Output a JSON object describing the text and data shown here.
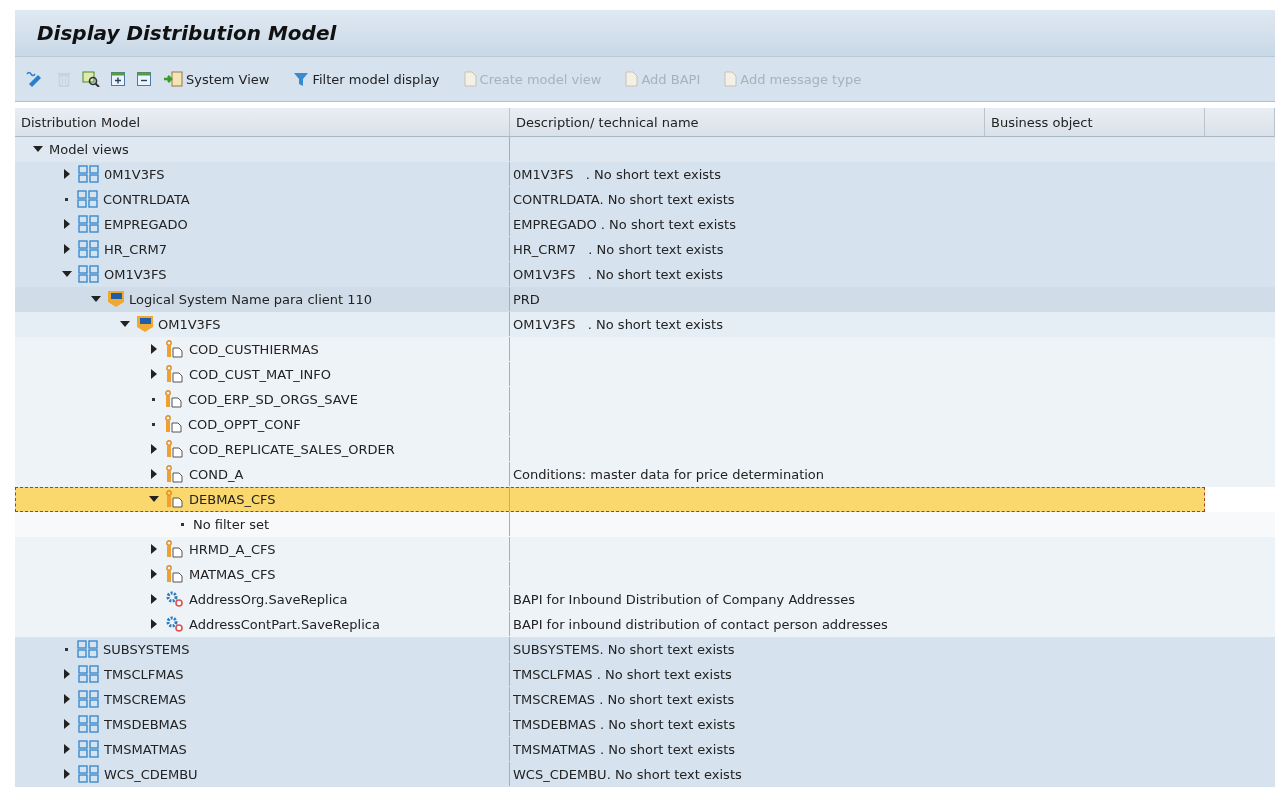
{
  "title": "Display Distribution Model",
  "toolbar": {
    "icon_buttons": [
      {
        "kind": "edit",
        "disabled": false
      },
      {
        "kind": "delete",
        "disabled": true
      },
      {
        "kind": "find",
        "disabled": false
      },
      {
        "kind": "expand",
        "disabled": false
      },
      {
        "kind": "collapse",
        "disabled": false
      }
    ],
    "buttons": [
      {
        "label": "System View",
        "kind": "system",
        "disabled": false
      },
      {
        "label": "Filter model display",
        "kind": "filter",
        "disabled": false
      },
      {
        "label": "Create model view",
        "kind": "document",
        "disabled": true
      },
      {
        "label": "Add BAPI",
        "kind": "document",
        "disabled": true
      },
      {
        "label": "Add message type",
        "kind": "document",
        "disabled": true
      }
    ]
  },
  "table": {
    "columns": [
      "Distribution Model",
      "Description/ technical name",
      "Business object"
    ],
    "tree": [
      {
        "label": "Model views",
        "kind": "folder",
        "leaf": false,
        "expanded": true,
        "selected": false,
        "children": [
          {
            "label": "0M1V3FS",
            "description": "0M1V3FS   . No short text exists",
            "kind": "model_view",
            "leaf": false,
            "expanded": false,
            "selected": false
          },
          {
            "label": "CONTRLDATA",
            "description": "CONTRLDATA. No short text exists",
            "kind": "model_view",
            "leaf": true,
            "selected": false
          },
          {
            "label": "EMPREGADO",
            "description": "EMPREGADO . No short text exists",
            "kind": "model_view",
            "leaf": false,
            "expanded": false,
            "selected": false
          },
          {
            "label": "HR_CRM7",
            "description": "HR_CRM7   . No short text exists",
            "kind": "model_view",
            "leaf": false,
            "expanded": false,
            "selected": false
          },
          {
            "label": "OM1V3FS",
            "description": "OM1V3FS   . No short text exists",
            "kind": "model_view",
            "leaf": false,
            "expanded": true,
            "selected": false,
            "children": [
              {
                "label": "Logical System Name para client 110",
                "description": "PRD",
                "kind": "sender_system",
                "leaf": false,
                "expanded": true,
                "selected": false,
                "children": [
                  {
                    "label": "OM1V3FS",
                    "description": "OM1V3FS   . No short text exists",
                    "kind": "receiver_system",
                    "leaf": false,
                    "expanded": true,
                    "selected": false,
                    "children": [
                      {
                        "label": "COD_CUSTHIERMAS",
                        "kind": "message_type",
                        "leaf": false,
                        "expanded": false,
                        "selected": false
                      },
                      {
                        "label": "COD_CUST_MAT_INFO",
                        "kind": "message_type",
                        "leaf": false,
                        "expanded": false,
                        "selected": false
                      },
                      {
                        "label": "COD_ERP_SD_ORGS_SAVE",
                        "kind": "message_type",
                        "leaf": true,
                        "selected": false
                      },
                      {
                        "label": "COD_OPPT_CONF",
                        "kind": "message_type",
                        "leaf": true,
                        "selected": false
                      },
                      {
                        "label": "COD_REPLICATE_SALES_ORDER",
                        "kind": "message_type",
                        "leaf": false,
                        "expanded": false,
                        "selected": false
                      },
                      {
                        "label": "COND_A",
                        "description": "Conditions: master data for price determination",
                        "kind": "message_type",
                        "leaf": false,
                        "expanded": false,
                        "selected": false
                      },
                      {
                        "label": "DEBMAS_CFS",
                        "kind": "message_type",
                        "leaf": false,
                        "expanded": true,
                        "selected": true,
                        "children": [
                          {
                            "label": "No filter set",
                            "kind": "filter",
                            "leaf": true,
                            "selected": false
                          }
                        ]
                      },
                      {
                        "label": "HRMD_A_CFS",
                        "kind": "message_type",
                        "leaf": false,
                        "expanded": false,
                        "selected": false
                      },
                      {
                        "label": "MATMAS_CFS",
                        "kind": "message_type",
                        "leaf": false,
                        "expanded": false,
                        "selected": false
                      },
                      {
                        "label": "AddressOrg.SaveReplica",
                        "description": "BAPI for Inbound Distribution of Company Addresses",
                        "kind": "bapi",
                        "leaf": false,
                        "expanded": false,
                        "selected": false
                      },
                      {
                        "label": "AddressContPart.SaveReplica",
                        "description": "BAPI for inbound distribution of contact person addresses",
                        "kind": "bapi",
                        "leaf": false,
                        "expanded": false,
                        "selected": false
                      }
                    ]
                  }
                ]
              }
            ]
          },
          {
            "label": "SUBSYSTEMS",
            "description": "SUBSYSTEMS. No short text exists",
            "kind": "model_view",
            "leaf": true,
            "selected": false
          },
          {
            "label": "TMSCLFMAS",
            "description": "TMSCLFMAS . No short text exists",
            "kind": "model_view",
            "leaf": false,
            "expanded": false,
            "selected": false
          },
          {
            "label": "TMSCREMAS",
            "description": "TMSCREMAS . No short text exists",
            "kind": "model_view",
            "leaf": false,
            "expanded": false,
            "selected": false
          },
          {
            "label": "TMSDEBMAS",
            "description": "TMSDEBMAS . No short text exists",
            "kind": "model_view",
            "leaf": false,
            "expanded": false,
            "selected": false
          },
          {
            "label": "TMSMATMAS",
            "description": "TMSMATMAS . No short text exists",
            "kind": "model_view",
            "leaf": false,
            "expanded": false,
            "selected": false
          },
          {
            "label": "WCS_CDEMBU",
            "description": "WCS_CDEMBU. No short text exists",
            "kind": "model_view",
            "leaf": false,
            "expanded": false,
            "selected": false
          }
        ]
      }
    ]
  }
}
